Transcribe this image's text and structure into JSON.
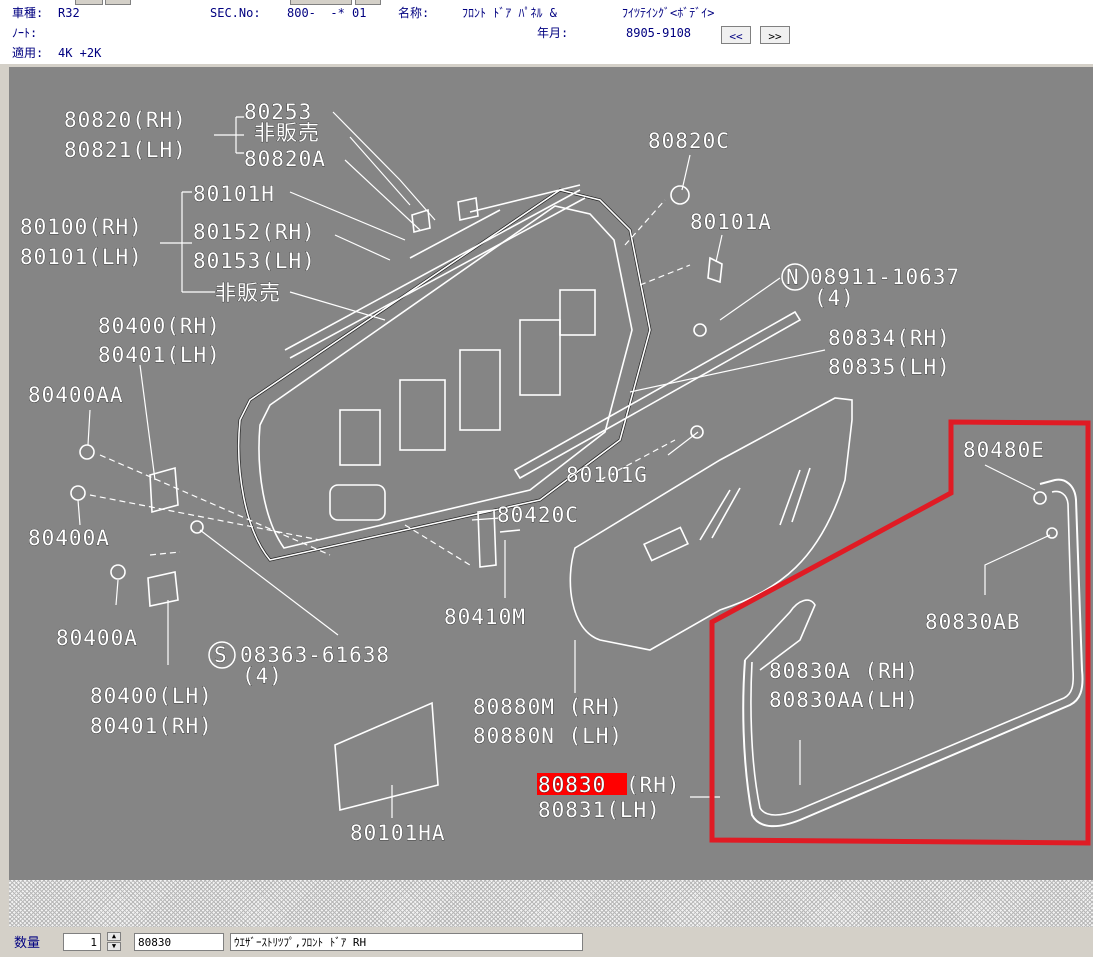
{
  "header": {
    "model_label": "車種:",
    "model_value": "R32",
    "sec_label": "SEC.No:",
    "sec_value": "800-  -* 01",
    "name_label": "名称:",
    "name_value": "ﾌﾛﾝﾄ ﾄﾞｱ ﾊﾟﾈﾙ &",
    "name_value2": "ﾌｲﾂﾃｲﾝｸﾞ<ﾎﾞﾃﾞｲ>",
    "note_label": "ﾉｰﾄ:",
    "note_value": "",
    "year_label": "年月:",
    "year_value": "8905-9108",
    "apply_label": "適用:",
    "apply_value": "4K +2K",
    "prev_button": "<<",
    "next_button": ">>"
  },
  "diagram": {
    "labels": {
      "p80820_rh": "80820(RH)",
      "p80821_lh": "80821(LH)",
      "p80253": "80253",
      "not_sold_1": "非販売",
      "p80820a": "80820A",
      "p80820c": "80820C",
      "p80101h": "80101H",
      "p80100_rh": "80100(RH)",
      "p80101_lh": "80101(LH)",
      "p80152_rh": "80152(RH)",
      "p80153_lh": "80153(LH)",
      "not_sold_2": "非販売",
      "p80101a": "80101A",
      "p08911_10637": "08911-10637",
      "qty_4a": "(4)",
      "p80400_rh": "80400(RH)",
      "p80401_lh": "80401(LH)",
      "p80834_rh": "80834(RH)",
      "p80835_lh": "80835(LH)",
      "p80400aa": "80400AA",
      "p80480e": "80480E",
      "p80101g": "80101G",
      "p80400a_1": "80400A",
      "p80420c": "80420C",
      "p80830ab": "80830AB",
      "p80410m": "80410M",
      "p80400a_2": "80400A",
      "p08363_61638": "08363-61638",
      "qty_4b": "(4)",
      "p80830a_rh": "80830A (RH)",
      "p80830aa_lh": "80830AA(LH)",
      "p80400_lh": "80400(LH)",
      "p80401_rh": "80401(RH)",
      "p80880m_rh": "80880M (RH)",
      "p80880n_lh": "80880N (LH)",
      "p80830_sel": "80830",
      "p80830_rh_suffix": "(RH)",
      "p80831_lh": "80831(LH)",
      "p80101ha": "80101HA",
      "circle_n": "N",
      "circle_s": "S"
    },
    "highlight_color": "#e01b24",
    "selection_color": "#ff0000"
  },
  "status": {
    "qty_label": "数量",
    "qty_value": "1",
    "part_no": "80830",
    "part_desc": "ｳｴｻﾞｰｽﾄﾘﾂﾌﾟ,ﾌﾛﾝﾄ ﾄﾞｱ RH",
    "extra": ""
  }
}
